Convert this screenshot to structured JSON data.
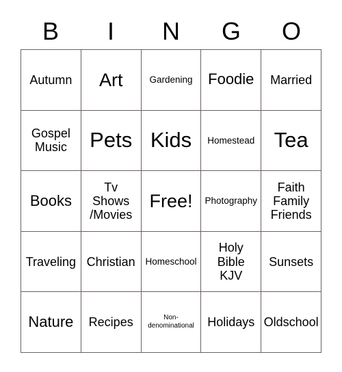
{
  "card": {
    "title_letters": [
      "B",
      "I",
      "N",
      "G",
      "O"
    ],
    "columns": 5,
    "rows": 5,
    "border_color": "#6b6060",
    "background_color": "#ffffff",
    "text_color": "#000000",
    "cells": [
      {
        "text": "Autumn",
        "size": "m"
      },
      {
        "text": "Art",
        "size": "xl"
      },
      {
        "text": "Gardening",
        "size": "s"
      },
      {
        "text": "Foodie",
        "size": "l"
      },
      {
        "text": "Married",
        "size": "m"
      },
      {
        "text": "Gospel\nMusic",
        "size": "m"
      },
      {
        "text": "Pets",
        "size": "xxl"
      },
      {
        "text": "Kids",
        "size": "xxl"
      },
      {
        "text": "Homestead",
        "size": "s"
      },
      {
        "text": "Tea",
        "size": "xxl"
      },
      {
        "text": "Books",
        "size": "l"
      },
      {
        "text": "Tv\nShows\n/Movies",
        "size": "m"
      },
      {
        "text": "Free!",
        "size": "xl"
      },
      {
        "text": "Photography",
        "size": "s"
      },
      {
        "text": "Faith\nFamily\nFriends",
        "size": "m"
      },
      {
        "text": "Traveling",
        "size": "m"
      },
      {
        "text": "Christian",
        "size": "m"
      },
      {
        "text": "Homeschool",
        "size": "s"
      },
      {
        "text": "Holy\nBible\nKJV",
        "size": "m"
      },
      {
        "text": "Sunsets",
        "size": "m"
      },
      {
        "text": "Nature",
        "size": "l"
      },
      {
        "text": "Recipes",
        "size": "m"
      },
      {
        "text": "Non-\ndenominational",
        "size": "xs"
      },
      {
        "text": "Holidays",
        "size": "m"
      },
      {
        "text": "Oldschool",
        "size": "m"
      }
    ]
  }
}
